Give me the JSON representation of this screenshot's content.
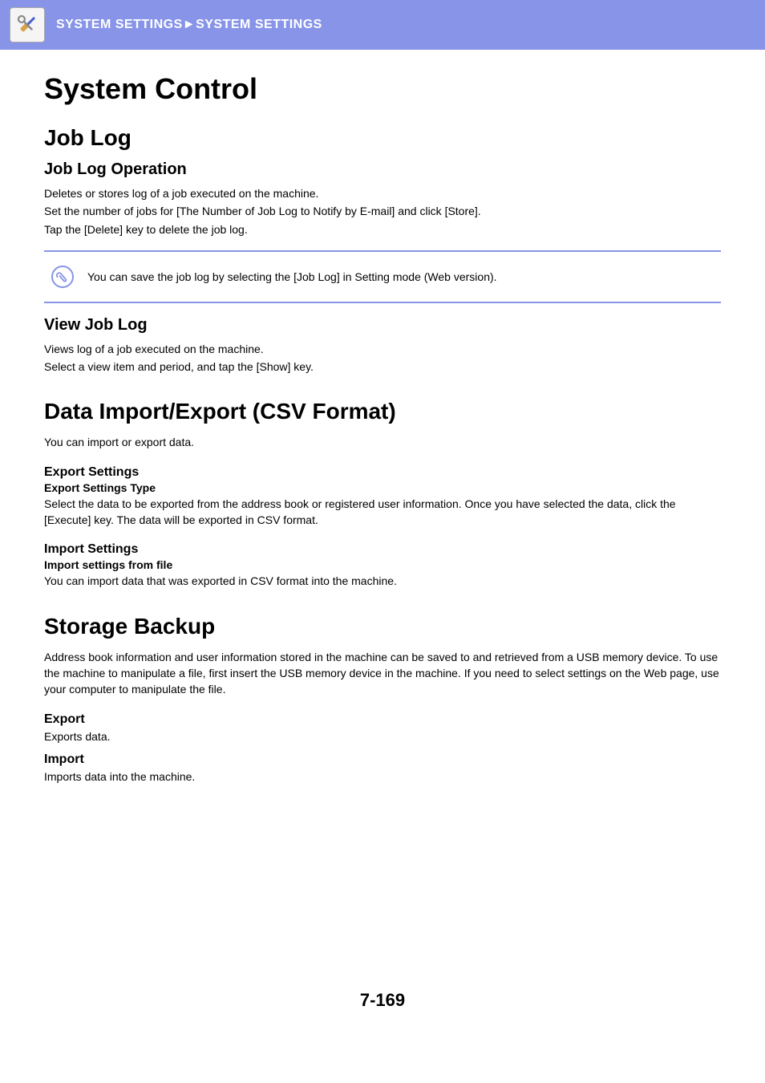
{
  "header": {
    "breadcrumb_part1": "SYSTEM SETTINGS",
    "breadcrumb_separator": "►",
    "breadcrumb_part2": "SYSTEM SETTINGS"
  },
  "page_title": "System Control",
  "job_log": {
    "heading": "Job Log",
    "operation": {
      "heading": "Job Log Operation",
      "p1": "Deletes or stores log of a job executed on the machine.",
      "p2": "Set the number of jobs for [The Number of Job Log to Notify by E-mail] and click [Store].",
      "p3": "Tap the [Delete] key to delete the job log."
    },
    "note": "You can save the job log by selecting the [Job Log] in Setting mode (Web version).",
    "view": {
      "heading": "View Job Log",
      "p1": "Views log of a job executed on the machine.",
      "p2": "Select a view item and period, and tap the [Show] key."
    }
  },
  "data_io": {
    "heading": "Data Import/Export (CSV Format)",
    "intro": "You can import or export data.",
    "export": {
      "heading": "Export Settings",
      "sub": "Export Settings Type",
      "p": "Select the data to be exported from the address book or registered user information. Once you have selected the data, click the [Execute] key. The data will be exported in CSV format."
    },
    "import": {
      "heading": "Import Settings",
      "sub": "Import settings from file",
      "p": "You can import data that was exported in CSV format into the machine."
    }
  },
  "storage": {
    "heading": "Storage Backup",
    "intro": "Address book information and user information stored in the machine can be saved to and retrieved from a USB memory device. To use the machine to manipulate a file, first insert the USB memory device in the machine. If you need to select settings on the Web page, use your computer to manipulate the file.",
    "export": {
      "heading": "Export",
      "p": "Exports data."
    },
    "import": {
      "heading": "Import",
      "p": "Imports data into the machine."
    }
  },
  "page_number": "7-169"
}
